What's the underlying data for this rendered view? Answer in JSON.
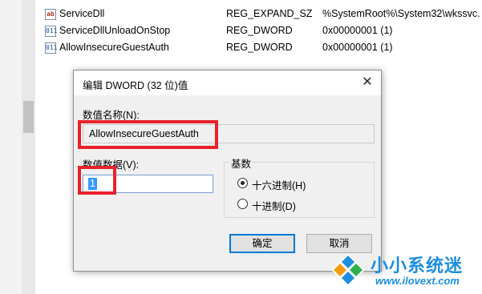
{
  "registry": {
    "rows": [
      {
        "name": "ServiceDll",
        "type": "REG_EXPAND_SZ",
        "data": "%SystemRoot%\\System32\\wkssvc.",
        "icon": "string-value-icon"
      },
      {
        "name": "ServiceDllUnloadOnStop",
        "type": "REG_DWORD",
        "data": "0x00000001 (1)",
        "icon": "dword-value-icon"
      },
      {
        "name": "AllowInsecureGuestAuth",
        "type": "REG_DWORD",
        "data": "0x00000001 (1)",
        "icon": "dword-value-icon"
      }
    ]
  },
  "dialog": {
    "title": "编辑 DWORD (32 位)值",
    "name_label": "数值名称(N):",
    "name_value": "AllowInsecureGuestAuth",
    "data_label": "数值数据(V):",
    "data_value": "1",
    "base_label": "基数",
    "radio_hex": "十六进制(H)",
    "radio_dec": "十进制(D)",
    "selected_base": "hex",
    "ok_label": "确定",
    "cancel_label": "取消",
    "close_glyph": "✕"
  },
  "watermark": {
    "brand": "小小系统迷",
    "url": "www.ilovext.com"
  },
  "colors": {
    "highlight": "#e8222a",
    "accent": "#0078d7",
    "watermark": "#1d8ee0"
  }
}
